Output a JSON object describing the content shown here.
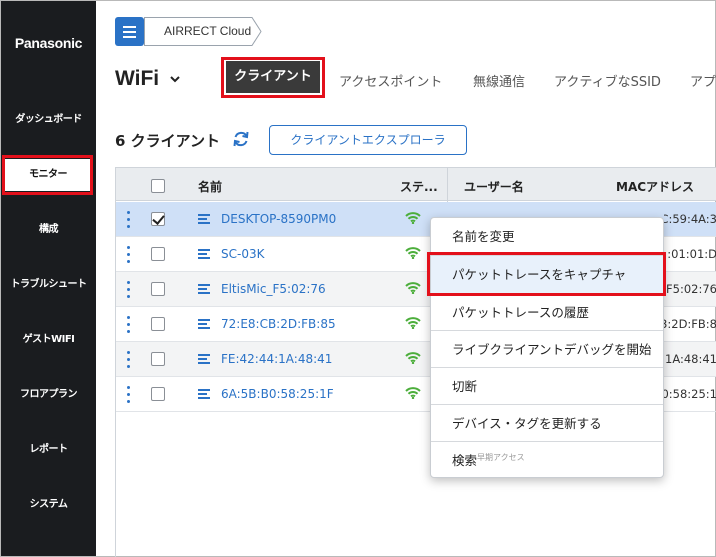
{
  "brand": "Panasonic",
  "sidebar": {
    "items": [
      {
        "label": "ダッシュボード"
      },
      {
        "label": "モニター",
        "active": true
      },
      {
        "label": "構成"
      },
      {
        "label": "トラブルシュート"
      },
      {
        "label": "ゲストWIFI"
      },
      {
        "label": "フロアプラン"
      },
      {
        "label": "レポート"
      },
      {
        "label": "システム"
      }
    ]
  },
  "header": {
    "breadcrumb": "AIRRECT Cloud",
    "title": "WiFi",
    "tabs": [
      {
        "label": "クライアント",
        "active": true
      },
      {
        "label": "アクセスポイント"
      },
      {
        "label": "無線通信"
      },
      {
        "label": "アクティブなSSID"
      },
      {
        "label": "アプ"
      }
    ]
  },
  "clients": {
    "count_label": "6 クライアント",
    "explorer_button": "クライアントエクスプローラ",
    "columns": {
      "name": "名前",
      "status": "ステ...",
      "user": "ユーザー名",
      "mac": "MACアドレス"
    },
    "rows": [
      {
        "name": "DESKTOP-8590PM0",
        "mac": "5C:B2:BC:59:4A:3",
        "selected": true
      },
      {
        "name": "SC-03K",
        "mac": ":01:01:D"
      },
      {
        "name": "EltisMic_F5:02:76",
        "mac": "F5:02:76"
      },
      {
        "name": "72:E8:CB:2D:FB:85",
        "mac": "3:2D:FB:8"
      },
      {
        "name": "FE:42:44:1A:48:41",
        "mac": ":1A:48:41"
      },
      {
        "name": "6A:5B:B0:58:25:1F",
        "mac": "0:58:25:1"
      }
    ]
  },
  "context_menu": {
    "items": [
      {
        "label": "名前を変更"
      },
      {
        "label": "パケットトレースをキャプチャ",
        "highlighted": true
      },
      {
        "label": "パケットトレースの履歴"
      },
      {
        "label": "ライブクライアントデバッグを開始"
      },
      {
        "label": "切断"
      },
      {
        "label": "デバイス・タグを更新する"
      },
      {
        "label": "検索",
        "sub": "早期アクセス"
      }
    ]
  },
  "colors": {
    "accent": "#2a72c6",
    "sidebar": "#1a1c1f",
    "highlight": "#e3101b"
  }
}
